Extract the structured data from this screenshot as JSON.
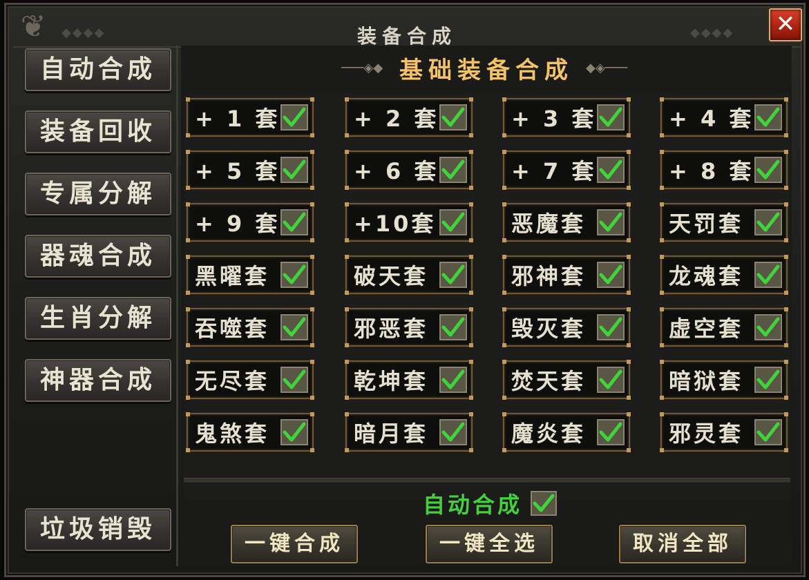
{
  "window": {
    "title": "装备合成",
    "close_label": "✕"
  },
  "sidebar": {
    "items": [
      {
        "label": "自动合成"
      },
      {
        "label": "装备回收"
      },
      {
        "label": "专属分解"
      },
      {
        "label": "器魂合成"
      },
      {
        "label": "生肖分解"
      },
      {
        "label": "神器合成"
      }
    ],
    "bottom_item": {
      "label": "垃圾销毁"
    }
  },
  "main": {
    "section_title": "基础装备合成",
    "sets": [
      {
        "label": "+ 1 套",
        "checked": true
      },
      {
        "label": "+ 2 套",
        "checked": true
      },
      {
        "label": "+ 3 套",
        "checked": true
      },
      {
        "label": "+ 4 套",
        "checked": true
      },
      {
        "label": "+ 5 套",
        "checked": true
      },
      {
        "label": "+ 6 套",
        "checked": true
      },
      {
        "label": "+ 7 套",
        "checked": true
      },
      {
        "label": "+ 8 套",
        "checked": true
      },
      {
        "label": "+ 9 套",
        "checked": true
      },
      {
        "label": "+10套",
        "checked": true
      },
      {
        "label": "恶魔套",
        "checked": true
      },
      {
        "label": "天罚套",
        "checked": true
      },
      {
        "label": "黑曜套",
        "checked": true
      },
      {
        "label": "破天套",
        "checked": true
      },
      {
        "label": "邪神套",
        "checked": true
      },
      {
        "label": "龙魂套",
        "checked": true
      },
      {
        "label": "吞噬套",
        "checked": true
      },
      {
        "label": "邪恶套",
        "checked": true
      },
      {
        "label": "毁灭套",
        "checked": true
      },
      {
        "label": "虚空套",
        "checked": true
      },
      {
        "label": "无尽套",
        "checked": true
      },
      {
        "label": "乾坤套",
        "checked": true
      },
      {
        "label": "焚天套",
        "checked": true
      },
      {
        "label": "暗狱套",
        "checked": true
      },
      {
        "label": "鬼煞套",
        "checked": true
      },
      {
        "label": "暗月套",
        "checked": true
      },
      {
        "label": "魔炎套",
        "checked": true
      },
      {
        "label": "邪灵套",
        "checked": true
      }
    ],
    "auto_merge": {
      "label": "自动合成",
      "checked": true
    },
    "actions": {
      "merge_all": "一键合成",
      "select_all": "一键全选",
      "cancel_all": "取消全部"
    }
  },
  "colors": {
    "accent_gold": "#f2c36a",
    "check_green": "#3fd43a",
    "auto_label_green": "#42d13c",
    "close_red": "#c0301a"
  }
}
